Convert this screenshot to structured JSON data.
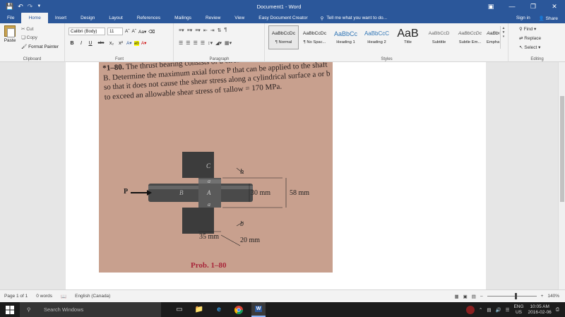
{
  "window": {
    "title": "Document1 - Word",
    "qat_icons": [
      "save-icon",
      "undo-icon",
      "redo-icon",
      "customize-icon"
    ]
  },
  "tabs": [
    "File",
    "Home",
    "Insert",
    "Design",
    "Layout",
    "References",
    "Mailings",
    "Review",
    "View",
    "Easy Document Creator"
  ],
  "tell_me": "Tell me what you want to do...",
  "account": {
    "sign_in": "Sign in",
    "share": "Share"
  },
  "ribbon": {
    "clipboard": {
      "paste": "Paste",
      "cut": "Cut",
      "copy": "Copy",
      "format_painter": "Format Painter",
      "label": "Clipboard"
    },
    "font": {
      "name": "Calibri (Body)",
      "size": "11",
      "label": "Font",
      "formats": [
        "B",
        "I",
        "U",
        "abc",
        "x₂",
        "x²"
      ]
    },
    "paragraph": {
      "label": "Paragraph"
    },
    "styles": {
      "label": "Styles",
      "items": [
        {
          "sample": "AaBbCcDc",
          "name": "¶ Normal"
        },
        {
          "sample": "AaBbCcDc",
          "name": "¶ No Spac..."
        },
        {
          "sample": "AaBbCс",
          "name": "Heading 1"
        },
        {
          "sample": "AaBbCcC",
          "name": "Heading 2"
        },
        {
          "sample": "AaB",
          "name": "Title"
        },
        {
          "sample": "AaBbCcD",
          "name": "Subtitle"
        },
        {
          "sample": "AaBbCcDc",
          "name": "Subtle Em..."
        },
        {
          "sample": "AaBbCcDc",
          "name": "Emphasis"
        }
      ]
    },
    "editing": {
      "find": "Find",
      "replace": "Replace",
      "select": "Select",
      "label": "Editing"
    }
  },
  "document": {
    "problem_number": "*1–80.",
    "problem_text": "The thrust bearing consists of a circular collar A fixed to the shaft B. Determine the maximum axial force P that can be applied to the shaft so that it does not cause the shear stress along a cylindrical surface a or b to exceed an allowable shear stress of τallow = 170 MPa.",
    "figure": {
      "labels": {
        "P": "P",
        "A": "A",
        "B": "B",
        "C": "C",
        "a_top": "a",
        "a_bottom": "a",
        "b_top": "b",
        "b_bottom": "b"
      },
      "dimensions": {
        "d1": "30 mm",
        "d2": "58 mm",
        "t1": "35 mm",
        "t2": "20 mm"
      }
    },
    "caption": "Prob. 1–80"
  },
  "status": {
    "page": "Page 1 of 1",
    "words": "0 words",
    "language": "English (Canada)",
    "zoom": "140%"
  },
  "taskbar": {
    "search": "Search Windows",
    "apps": [
      "task-view-icon",
      "file-explorer-icon",
      "ie-icon",
      "chrome-icon",
      "word-icon"
    ],
    "lang": "ENG",
    "region": "US",
    "time": "10:05 AM",
    "date": "2016-02-06"
  },
  "colors": {
    "brand": "#2b579a",
    "photo_bg": "#c8a08e",
    "caption": "#a8263a",
    "taskbar": "#1c1c1c"
  }
}
